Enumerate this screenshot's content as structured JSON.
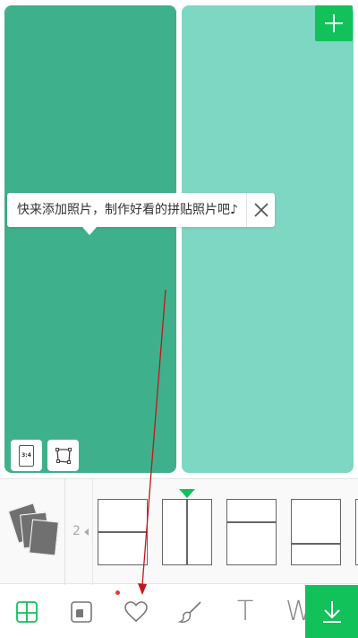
{
  "colors": {
    "accent": "#13c15a",
    "panel_left": "#3fb08c",
    "panel_right": "#7ed7c2",
    "annotation": "#c0161c"
  },
  "tooltip": {
    "message": "快来添加照片，制作好看的拼贴照片吧♪",
    "close_icon": "close-icon"
  },
  "panel_controls": {
    "ratio_label": "3:4",
    "crop_icon": "crop-corners-icon"
  },
  "layout_strip": {
    "photo_count": "2",
    "layouts": [
      "top-bottom split",
      "left-right split",
      "top-bottom split small",
      "top-bottom split large",
      "partial"
    ],
    "selected_index": 1
  },
  "toolbar": {
    "items": [
      "layout-icon",
      "frame-icon",
      "heart-icon",
      "brush-icon",
      "text-icon",
      "watermark-icon"
    ],
    "text_glyph": "T",
    "watermark_glyph": "W",
    "save_icon": "download-icon"
  }
}
